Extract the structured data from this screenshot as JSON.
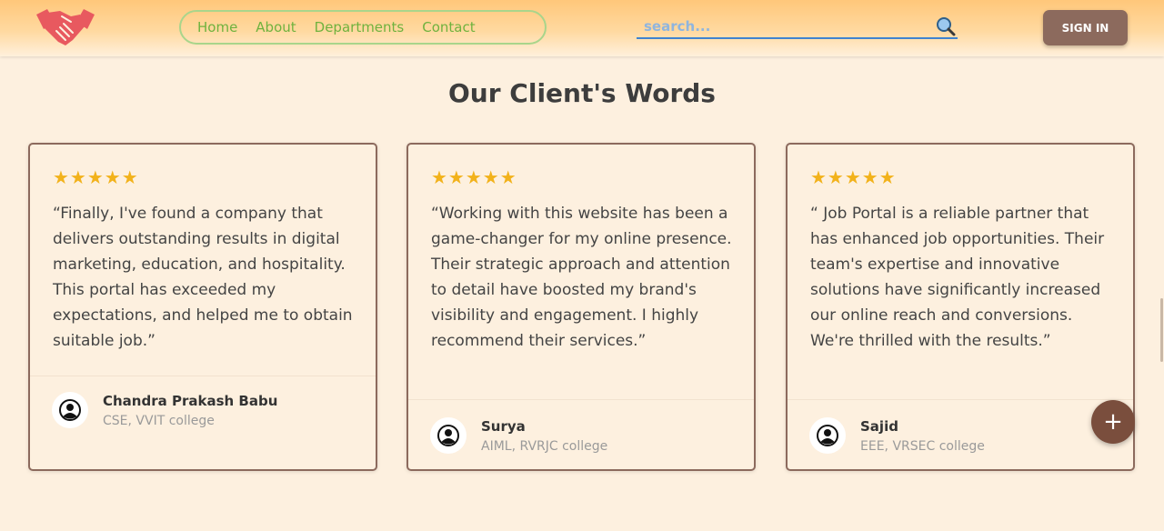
{
  "header": {
    "logo_icon": "handshake-icon",
    "nav": [
      "Home",
      "About",
      "Departments",
      "Contact"
    ],
    "search_placeholder": "search...",
    "search_icon": "magnifier-icon",
    "signin_label": "SIGN IN"
  },
  "section_title": "Our Client's Words",
  "testimonials": [
    {
      "rating": 5,
      "stars": "★★★★★",
      "quote": "“Finally, I've found a company that delivers outstanding results in digital marketing, education, and hospitality. This portal has exceeded my expectations, and helped me to obtain suitable job.”",
      "name": "Chandra Prakash Babu",
      "role": "CSE, VVIT college",
      "avatar_icon": "user-icon"
    },
    {
      "rating": 5,
      "stars": "★★★★★",
      "quote": "“Working with this website has been a game-changer for my online presence. Their strategic approach and attention to detail have boosted my brand's visibility and engagement. I highly recommend their services.”",
      "name": "Surya",
      "role": "AIML, RVRJC college",
      "avatar_icon": "user-icon"
    },
    {
      "rating": 5,
      "stars": "★★★★★",
      "quote": "“ Job Portal is a reliable partner that has enhanced job opportunities. Their team's expertise and innovative solutions have significantly increased our online reach and conversions. We're thrilled with the results.”",
      "name": "Sajid",
      "role": "EEE, VRSEC college",
      "avatar_icon": "user-icon"
    }
  ],
  "fab_label": "+",
  "colors": {
    "accent": "#8c6a5d",
    "nav_text": "#6fb23e",
    "star": "#f2b21b",
    "background": "#fdf0df"
  }
}
